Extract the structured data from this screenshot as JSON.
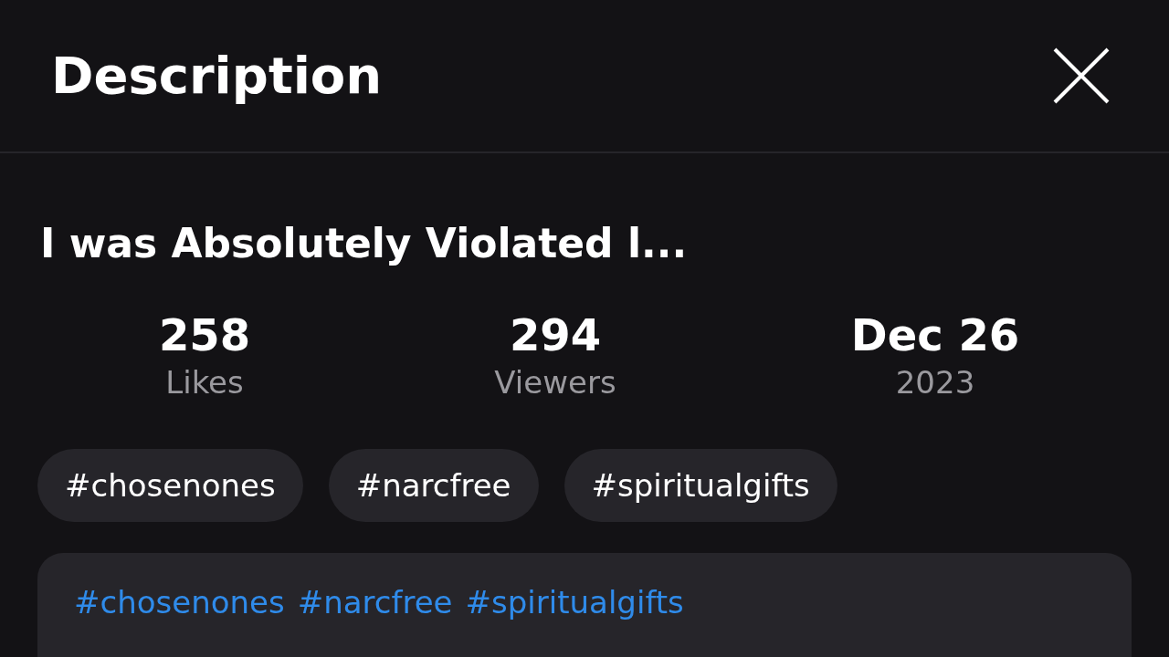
{
  "header": {
    "title": "Description"
  },
  "video_title": "I was Absolutely Violated l...",
  "stats": [
    {
      "value": "258",
      "label": "Likes"
    },
    {
      "value": "294",
      "label": "Viewers"
    },
    {
      "value": "Dec 26",
      "label": "2023"
    }
  ],
  "tags": [
    "#chosenones",
    "#narcfree",
    "#spiritualgifts"
  ],
  "description": {
    "links": [
      "#chosenones",
      "#narcfree",
      "#spiritualgifts"
    ]
  }
}
